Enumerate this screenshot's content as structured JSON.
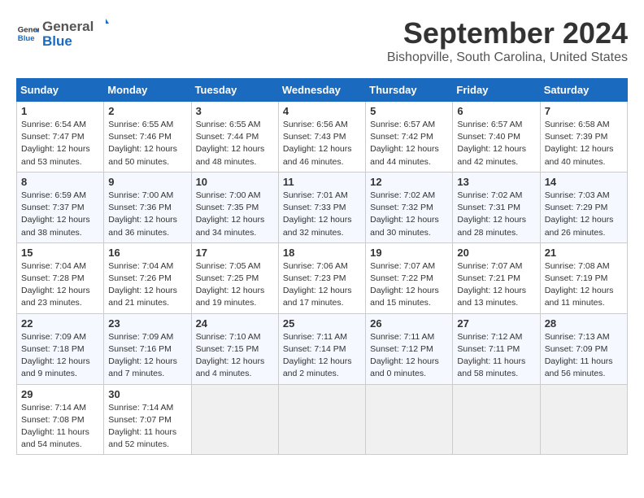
{
  "logo": {
    "general": "General",
    "blue": "Blue"
  },
  "title": "September 2024",
  "location": "Bishopville, South Carolina, United States",
  "weekdays": [
    "Sunday",
    "Monday",
    "Tuesday",
    "Wednesday",
    "Thursday",
    "Friday",
    "Saturday"
  ],
  "weeks": [
    [
      {
        "day": "1",
        "sunrise": "6:54 AM",
        "sunset": "7:47 PM",
        "daylight": "12 hours and 53 minutes."
      },
      {
        "day": "2",
        "sunrise": "6:55 AM",
        "sunset": "7:46 PM",
        "daylight": "12 hours and 50 minutes."
      },
      {
        "day": "3",
        "sunrise": "6:55 AM",
        "sunset": "7:44 PM",
        "daylight": "12 hours and 48 minutes."
      },
      {
        "day": "4",
        "sunrise": "6:56 AM",
        "sunset": "7:43 PM",
        "daylight": "12 hours and 46 minutes."
      },
      {
        "day": "5",
        "sunrise": "6:57 AM",
        "sunset": "7:42 PM",
        "daylight": "12 hours and 44 minutes."
      },
      {
        "day": "6",
        "sunrise": "6:57 AM",
        "sunset": "7:40 PM",
        "daylight": "12 hours and 42 minutes."
      },
      {
        "day": "7",
        "sunrise": "6:58 AM",
        "sunset": "7:39 PM",
        "daylight": "12 hours and 40 minutes."
      }
    ],
    [
      {
        "day": "8",
        "sunrise": "6:59 AM",
        "sunset": "7:37 PM",
        "daylight": "12 hours and 38 minutes."
      },
      {
        "day": "9",
        "sunrise": "7:00 AM",
        "sunset": "7:36 PM",
        "daylight": "12 hours and 36 minutes."
      },
      {
        "day": "10",
        "sunrise": "7:00 AM",
        "sunset": "7:35 PM",
        "daylight": "12 hours and 34 minutes."
      },
      {
        "day": "11",
        "sunrise": "7:01 AM",
        "sunset": "7:33 PM",
        "daylight": "12 hours and 32 minutes."
      },
      {
        "day": "12",
        "sunrise": "7:02 AM",
        "sunset": "7:32 PM",
        "daylight": "12 hours and 30 minutes."
      },
      {
        "day": "13",
        "sunrise": "7:02 AM",
        "sunset": "7:31 PM",
        "daylight": "12 hours and 28 minutes."
      },
      {
        "day": "14",
        "sunrise": "7:03 AM",
        "sunset": "7:29 PM",
        "daylight": "12 hours and 26 minutes."
      }
    ],
    [
      {
        "day": "15",
        "sunrise": "7:04 AM",
        "sunset": "7:28 PM",
        "daylight": "12 hours and 23 minutes."
      },
      {
        "day": "16",
        "sunrise": "7:04 AM",
        "sunset": "7:26 PM",
        "daylight": "12 hours and 21 minutes."
      },
      {
        "day": "17",
        "sunrise": "7:05 AM",
        "sunset": "7:25 PM",
        "daylight": "12 hours and 19 minutes."
      },
      {
        "day": "18",
        "sunrise": "7:06 AM",
        "sunset": "7:23 PM",
        "daylight": "12 hours and 17 minutes."
      },
      {
        "day": "19",
        "sunrise": "7:07 AM",
        "sunset": "7:22 PM",
        "daylight": "12 hours and 15 minutes."
      },
      {
        "day": "20",
        "sunrise": "7:07 AM",
        "sunset": "7:21 PM",
        "daylight": "12 hours and 13 minutes."
      },
      {
        "day": "21",
        "sunrise": "7:08 AM",
        "sunset": "7:19 PM",
        "daylight": "12 hours and 11 minutes."
      }
    ],
    [
      {
        "day": "22",
        "sunrise": "7:09 AM",
        "sunset": "7:18 PM",
        "daylight": "12 hours and 9 minutes."
      },
      {
        "day": "23",
        "sunrise": "7:09 AM",
        "sunset": "7:16 PM",
        "daylight": "12 hours and 7 minutes."
      },
      {
        "day": "24",
        "sunrise": "7:10 AM",
        "sunset": "7:15 PM",
        "daylight": "12 hours and 4 minutes."
      },
      {
        "day": "25",
        "sunrise": "7:11 AM",
        "sunset": "7:14 PM",
        "daylight": "12 hours and 2 minutes."
      },
      {
        "day": "26",
        "sunrise": "7:11 AM",
        "sunset": "7:12 PM",
        "daylight": "12 hours and 0 minutes."
      },
      {
        "day": "27",
        "sunrise": "7:12 AM",
        "sunset": "7:11 PM",
        "daylight": "11 hours and 58 minutes."
      },
      {
        "day": "28",
        "sunrise": "7:13 AM",
        "sunset": "7:09 PM",
        "daylight": "11 hours and 56 minutes."
      }
    ],
    [
      {
        "day": "29",
        "sunrise": "7:14 AM",
        "sunset": "7:08 PM",
        "daylight": "11 hours and 54 minutes."
      },
      {
        "day": "30",
        "sunrise": "7:14 AM",
        "sunset": "7:07 PM",
        "daylight": "11 hours and 52 minutes."
      },
      null,
      null,
      null,
      null,
      null
    ]
  ]
}
